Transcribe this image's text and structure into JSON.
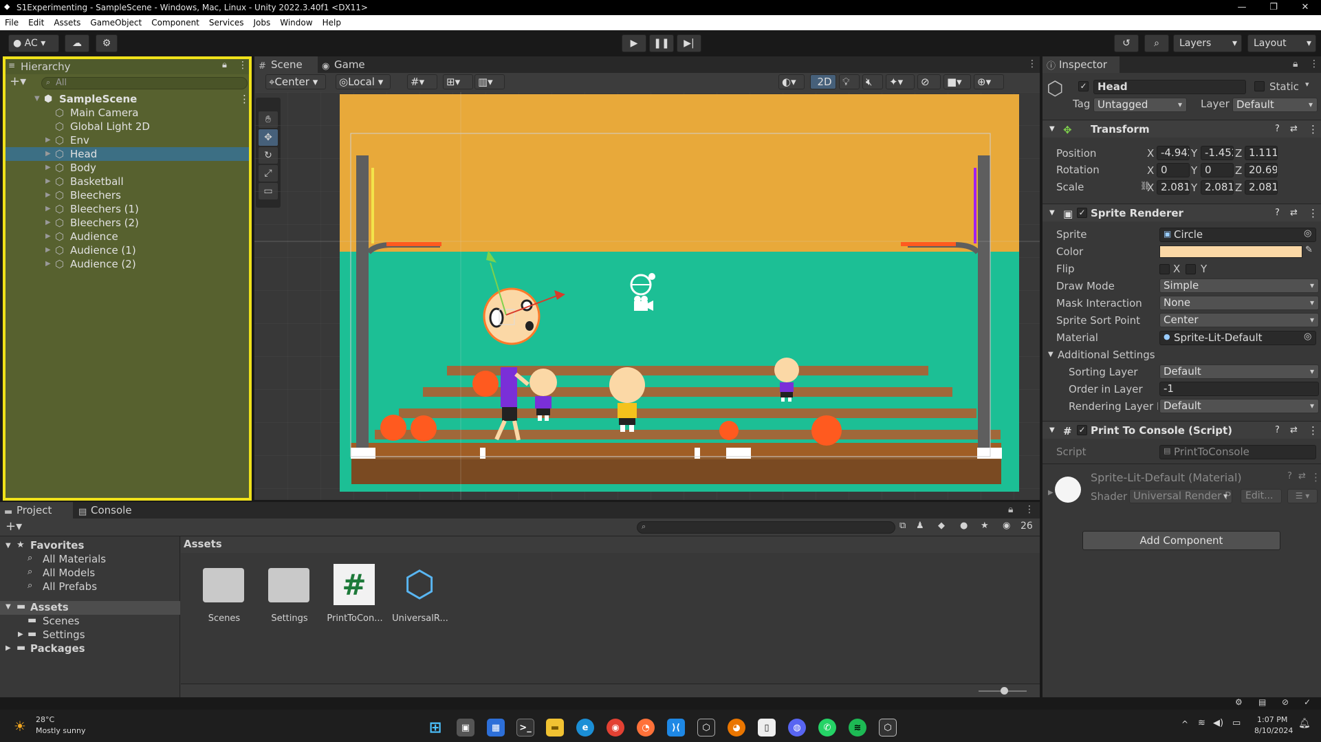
{
  "window": {
    "title": "S1Experimenting - SampleScene - Windows, Mac, Linux - Unity 2022.3.40f1 <DX11>"
  },
  "menu": [
    "File",
    "Edit",
    "Assets",
    "GameObject",
    "Component",
    "Services",
    "Jobs",
    "Window",
    "Help"
  ],
  "toolbar": {
    "account": "AC",
    "layers": "Layers",
    "layout": "Layout"
  },
  "hierarchy": {
    "tab": "Hierarchy",
    "search_placeholder": "All",
    "scene": "SampleScene",
    "items": [
      {
        "label": "Main Camera",
        "expandable": false,
        "selected": false
      },
      {
        "label": "Global Light 2D",
        "expandable": false,
        "selected": false
      },
      {
        "label": "Env",
        "expandable": true,
        "selected": false
      },
      {
        "label": "Head",
        "expandable": true,
        "selected": true
      },
      {
        "label": "Body",
        "expandable": true,
        "selected": false
      },
      {
        "label": "Basketball",
        "expandable": true,
        "selected": false
      },
      {
        "label": "Bleechers",
        "expandable": true,
        "selected": false
      },
      {
        "label": "Bleechers (1)",
        "expandable": true,
        "selected": false
      },
      {
        "label": "Bleechers (2)",
        "expandable": true,
        "selected": false
      },
      {
        "label": "Audience",
        "expandable": true,
        "selected": false
      },
      {
        "label": "Audience (1)",
        "expandable": true,
        "selected": false
      },
      {
        "label": "Audience (2)",
        "expandable": true,
        "selected": false
      }
    ]
  },
  "scene_view": {
    "tabs": [
      "Scene",
      "Game"
    ],
    "pivot": "Center",
    "space": "Local",
    "mode_2d": "2D",
    "colors": {
      "wall": "#e8a93a",
      "court": "#1cbf95",
      "floor": "#7a4a22",
      "bleacher": "#a0683a",
      "ball": "#ff5a1f"
    }
  },
  "inspector": {
    "tab": "Inspector",
    "name": "Head",
    "static_label": "Static",
    "tag_label": "Tag",
    "tag": "Untagged",
    "layer_label": "Layer",
    "layer": "Default",
    "transform": {
      "title": "Transform",
      "position_label": "Position",
      "position": {
        "x": "-4.942",
        "y": "-1.452",
        "z": "1.1118"
      },
      "rotation_label": "Rotation",
      "rotation": {
        "x": "0",
        "y": "0",
        "z": "20.692"
      },
      "scale_label": "Scale",
      "scale": {
        "x": "2.0810",
        "y": "2.0810",
        "z": "2.0810"
      }
    },
    "sprite_renderer": {
      "title": "Sprite Renderer",
      "sprite_label": "Sprite",
      "sprite": "Circle",
      "color_label": "Color",
      "color": "#fbd8a6",
      "flip_label": "Flip",
      "flip_x": "X",
      "flip_y": "Y",
      "draw_mode_label": "Draw Mode",
      "draw_mode": "Simple",
      "mask_label": "Mask Interaction",
      "mask": "None",
      "sort_point_label": "Sprite Sort Point",
      "sort_point": "Center",
      "material_label": "Material",
      "material": "Sprite-Lit-Default",
      "additional_label": "Additional Settings",
      "sorting_layer_label": "Sorting Layer",
      "sorting_layer": "Default",
      "order_label": "Order in Layer",
      "order": "-1",
      "rendering_layer_label": "Rendering Layer M",
      "rendering_layer": "Default"
    },
    "script_component": {
      "title": "Print To Console (Script)",
      "script_label": "Script",
      "script": "PrintToConsole"
    },
    "material": {
      "title": "Sprite-Lit-Default (Material)",
      "shader_label": "Shader",
      "shader": "Universal Render P",
      "edit": "Edit..."
    },
    "add_component": "Add Component"
  },
  "project": {
    "tabs": [
      "Project",
      "Console"
    ],
    "favorites_label": "Favorites",
    "favorites": [
      "All Materials",
      "All Models",
      "All Prefabs"
    ],
    "assets_label": "Assets",
    "asset_folders": [
      "Scenes",
      "Settings"
    ],
    "packages_label": "Packages",
    "breadcrumb": "Assets",
    "hidden_count": "26",
    "items": [
      {
        "label": "Scenes",
        "kind": "folder"
      },
      {
        "label": "Settings",
        "kind": "folder"
      },
      {
        "label": "PrintToCon...",
        "kind": "script"
      },
      {
        "label": "UniversalR...",
        "kind": "asset"
      }
    ]
  },
  "taskbar": {
    "weather_temp": "28°C",
    "weather_desc": "Mostly sunny",
    "time": "1:07 PM",
    "date": "8/10/2024"
  }
}
